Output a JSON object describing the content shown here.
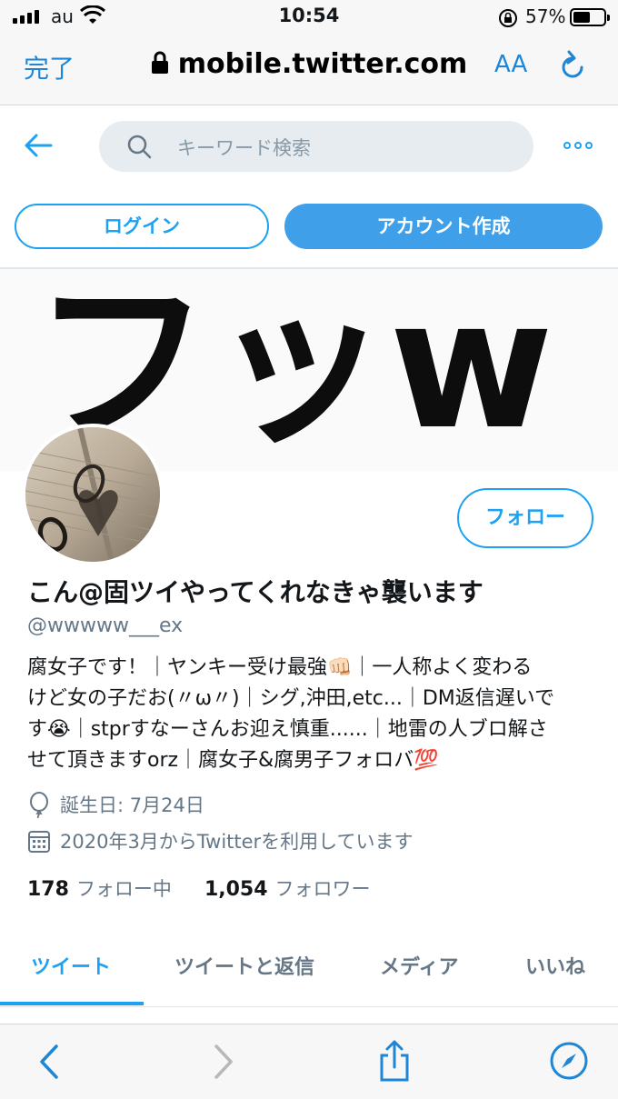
{
  "status_bar": {
    "carrier": "au",
    "time": "10:54",
    "battery": "57%",
    "battery_level": 0.57
  },
  "browser": {
    "done_label": "完了",
    "url": "mobile.twitter.com",
    "text_size_label": "AA"
  },
  "header": {
    "search_placeholder": "キーワード検索",
    "login_label": "ログイン",
    "signup_label": "アカウント作成"
  },
  "banner": {
    "text": "フッw"
  },
  "profile": {
    "follow_label": "フォロー",
    "display_name": "こん@固ツイやってくれなきゃ襲います",
    "handle": "@wwwww___ex",
    "bio_lines": [
      "腐女子です！｜ヤンキー受け最強👊🏻｜一人称よく変わる",
      "けど女の子だお(〃ω〃)｜シグ,沖田,etc...｜DM返信遅いで",
      "す😭｜stprすなーさんお迎え慎重......｜地雷の人ブロ解さ",
      "せて頂きますorz｜腐女子&腐男子フォロバ💯"
    ],
    "birthday": "誕生日: 7月24日",
    "joined": "2020年3月からTwitterを利用しています",
    "following_count": "178",
    "following_label": "フォロー中",
    "followers_count": "1,054",
    "followers_label": "フォロワー"
  },
  "tabs": [
    {
      "label": "ツイート",
      "active": true
    },
    {
      "label": "ツイートと返信",
      "active": false
    },
    {
      "label": "メディア",
      "active": false
    },
    {
      "label": "いいね",
      "active": false
    }
  ],
  "colors": {
    "accent": "#1da1f2",
    "safari_blue": "#1f86d6",
    "muted": "#657786"
  }
}
